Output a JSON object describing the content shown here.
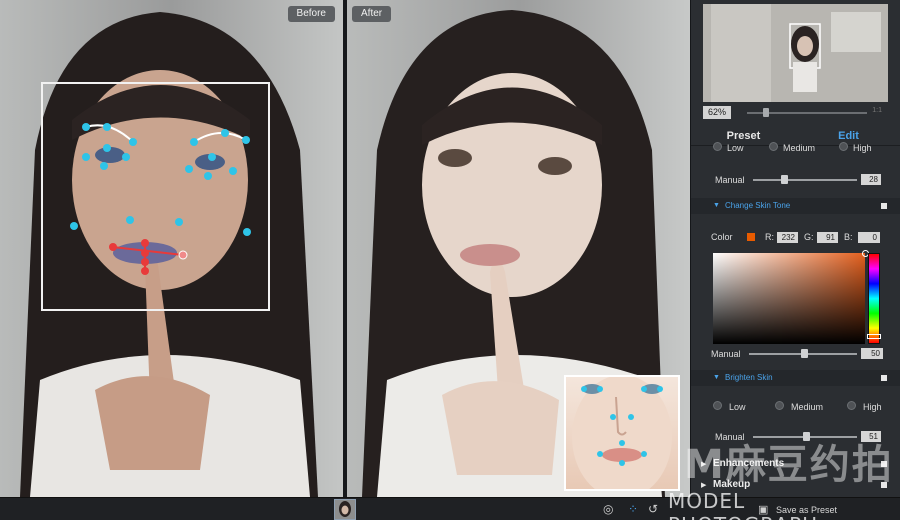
{
  "labels": {
    "before": "Before",
    "after": "After"
  },
  "navigator": {
    "zoom": "62%"
  },
  "tabs": [
    {
      "label": "Preset"
    },
    {
      "label": "Edit"
    }
  ],
  "top_options": [
    "Low",
    "Medium",
    "High"
  ],
  "manual1": {
    "label": "Manual",
    "value": "28",
    "level": 0.28
  },
  "skin_tone": {
    "title": "Change Skin Tone",
    "color_label": "Color",
    "r_label": "R:",
    "r": "232",
    "g_label": "G:",
    "g": "91",
    "b_label": "B:",
    "b": "0",
    "swatch_color": "#e85b00"
  },
  "manual2": {
    "label": "Manual",
    "value": "50",
    "level": 0.5
  },
  "brighten": {
    "title": "Brighten Skin",
    "options": [
      "Low",
      "Medium",
      "High"
    ]
  },
  "manual3": {
    "label": "Manual",
    "value": "51",
    "level": 0.51
  },
  "enhancements": {
    "title": "Enhancements"
  },
  "makeup": {
    "title": "Makeup"
  },
  "bottombar": {
    "save_label": "Save as Preset"
  },
  "watermark": {
    "logo": "M麻豆约拍",
    "text": "MODEL PHOTOGRAPH"
  },
  "colors": {
    "accent": "#4aa3ea",
    "panel": "#2b2e32",
    "landmark": "#2ec4e8",
    "lip_marker": "#e83a3a"
  }
}
